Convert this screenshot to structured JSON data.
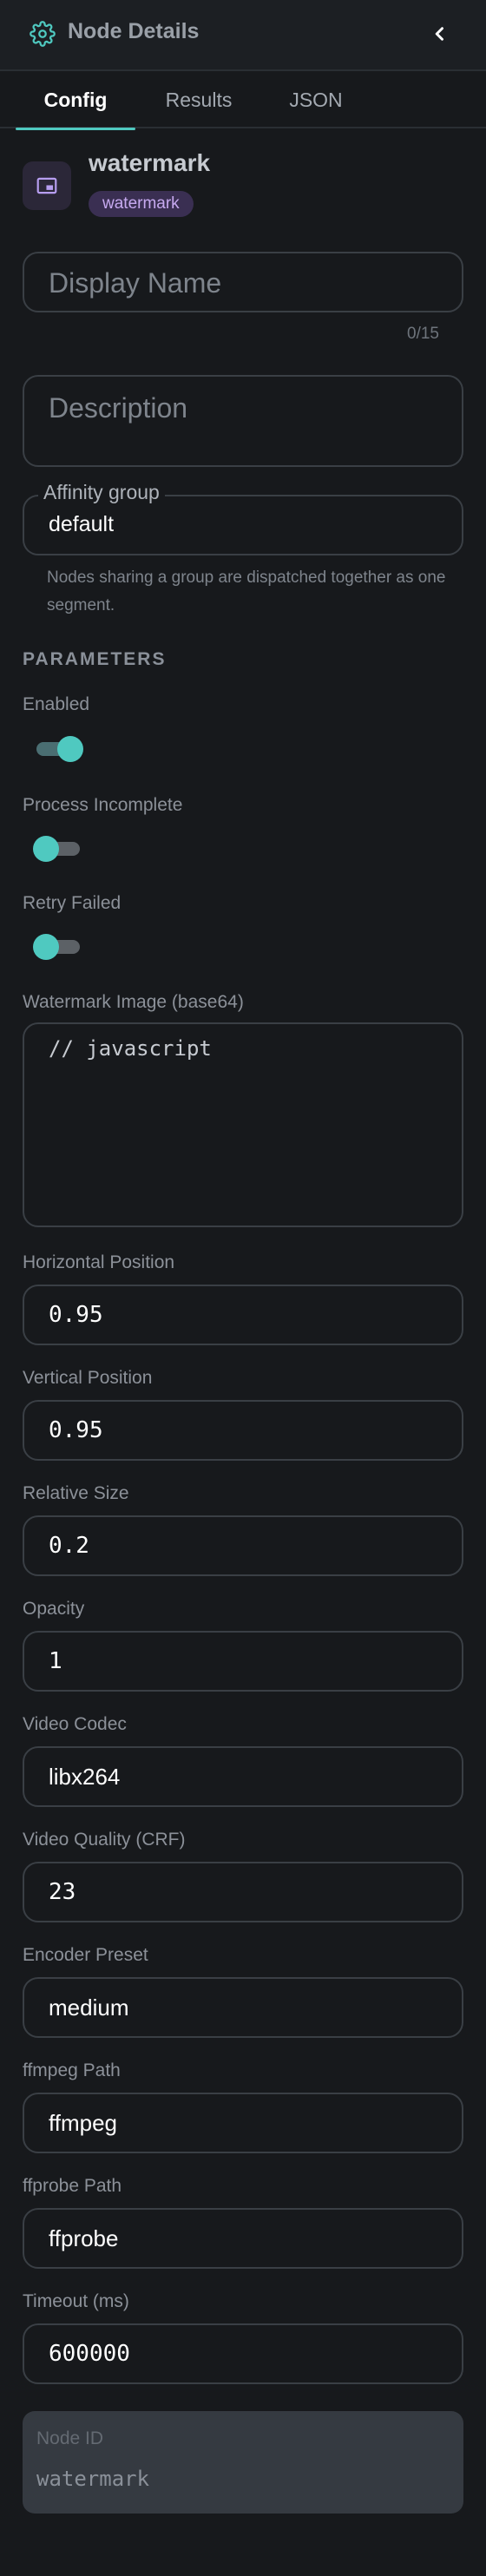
{
  "header": {
    "title": "Node Details",
    "icon": "gear-icon",
    "back_icon": "chevron-left-icon"
  },
  "tabs": [
    {
      "label": "Config",
      "active": true
    },
    {
      "label": "Results",
      "active": false
    },
    {
      "label": "JSON",
      "active": false
    }
  ],
  "node": {
    "name": "watermark",
    "type_badge": "watermark",
    "icon": "picture-in-picture-icon"
  },
  "display_name": {
    "placeholder": "Display Name",
    "counter": "0/15"
  },
  "description": {
    "placeholder": "Description"
  },
  "affinity": {
    "label": "Affinity group",
    "value": "default",
    "hint": "Nodes sharing a group are dispatched together as one segment."
  },
  "parameters": {
    "section_title": "PARAMETERS",
    "enabled": {
      "label": "Enabled",
      "on": true
    },
    "process_incomplete": {
      "label": "Process Incomplete",
      "on": false
    },
    "retry_failed": {
      "label": "Retry Failed",
      "on": false
    },
    "watermark_image": {
      "label": "Watermark Image (base64)",
      "code": "// javascript"
    },
    "horizontal_position": {
      "label": "Horizontal Position",
      "value": "0.95"
    },
    "vertical_position": {
      "label": "Vertical Position",
      "value": "0.95"
    },
    "relative_size": {
      "label": "Relative Size",
      "value": "0.2"
    },
    "opacity": {
      "label": "Opacity",
      "value": "1"
    },
    "video_codec": {
      "label": "Video Codec",
      "value": "libx264"
    },
    "video_quality": {
      "label": "Video Quality (CRF)",
      "value": "23"
    },
    "encoder_preset": {
      "label": "Encoder Preset",
      "value": "medium"
    },
    "ffmpeg_path": {
      "label": "ffmpeg Path",
      "value": "ffmpeg"
    },
    "ffprobe_path": {
      "label": "ffprobe Path",
      "value": "ffprobe"
    },
    "timeout": {
      "label": "Timeout (ms)",
      "value": "600000"
    }
  },
  "node_id": {
    "label": "Node ID",
    "value": "watermark"
  },
  "colors": {
    "accent": "#4fc9c0",
    "background": "#17191c",
    "badge_bg": "#3a2f52",
    "badge_text": "#c7aaf0"
  }
}
